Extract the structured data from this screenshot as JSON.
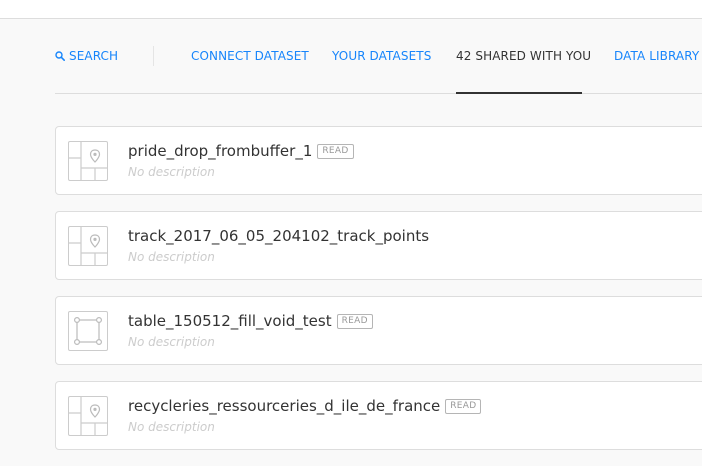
{
  "nav": {
    "search_label": "SEARCH",
    "connect_label": "CONNECT DATASET",
    "yours_label": "YOUR DATASETS",
    "shared_label": "42 SHARED WITH YOU",
    "library_label": "DATA LIBRARY"
  },
  "colors": {
    "accent": "#1785fb",
    "text": "#333333",
    "muted": "#cccccc"
  },
  "datasets": [
    {
      "name": "pride_drop_frombuffer_1",
      "badge": "READ",
      "description": "No description",
      "icon": "point-map-icon"
    },
    {
      "name": "track_2017_06_05_204102_track_points",
      "badge": "",
      "description": "No description",
      "icon": "point-map-icon"
    },
    {
      "name": "table_150512_fill_void_test",
      "badge": "READ",
      "description": "No description",
      "icon": "polygon-icon"
    },
    {
      "name": "recycleries_ressourceries_d_ile_de_france",
      "badge": "READ",
      "description": "No description",
      "icon": "point-map-icon"
    }
  ]
}
